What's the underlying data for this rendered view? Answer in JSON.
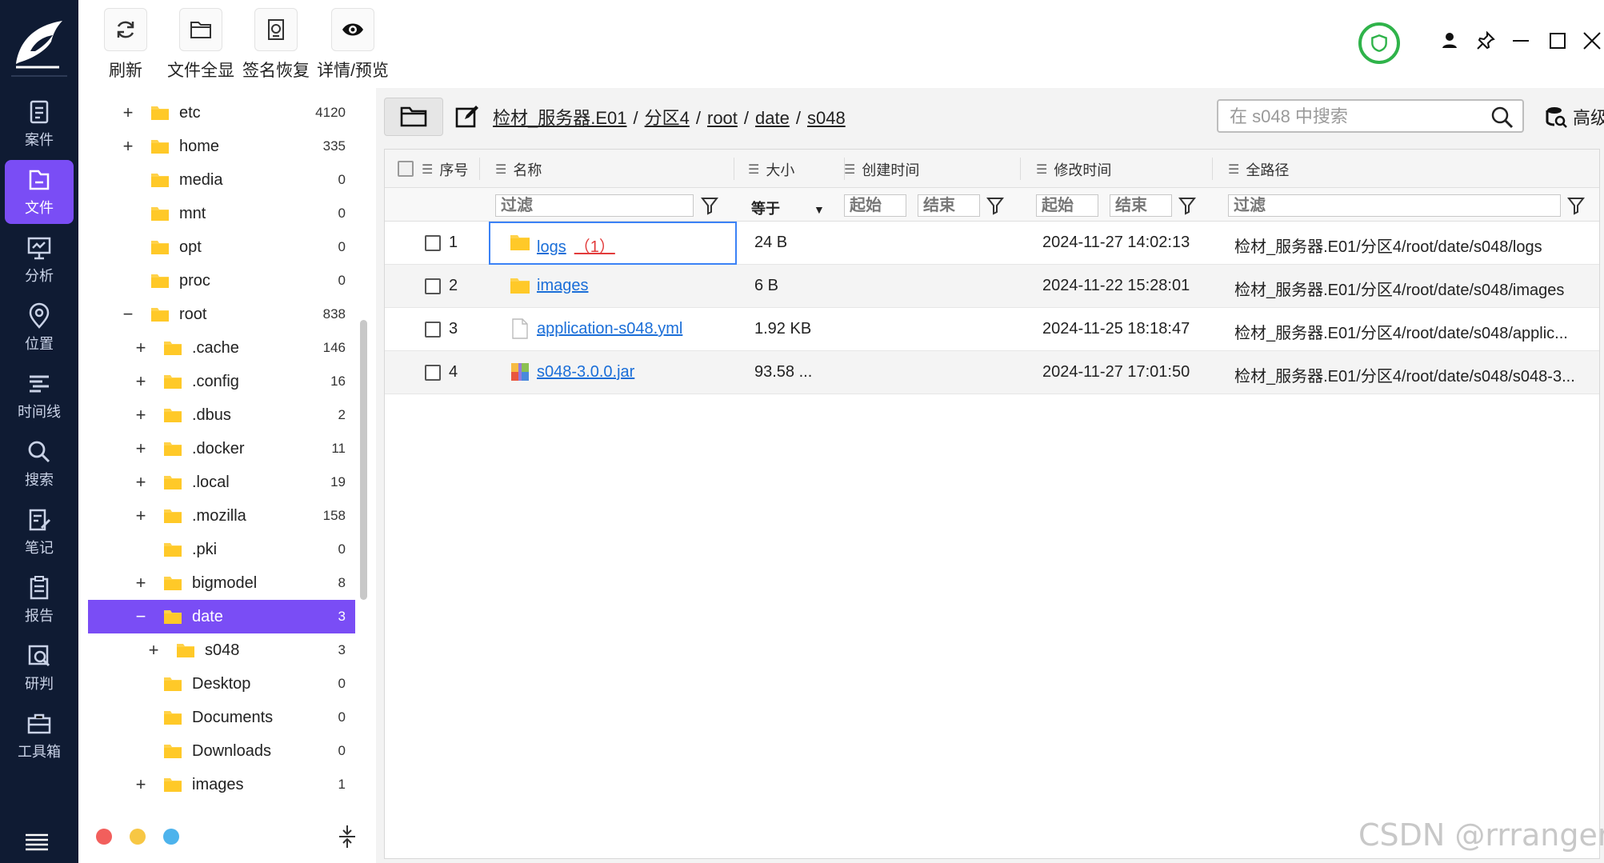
{
  "colors": {
    "nav_bg": "#0f1b33",
    "accent": "#7a4df5",
    "link": "#1a6ed8",
    "badge_red": "#e23b3b",
    "shield_green": "#2fb34a"
  },
  "leftnav": {
    "items": [
      {
        "label": "案件",
        "icon": "case-icon"
      },
      {
        "label": "文件",
        "icon": "file-icon",
        "active": true
      },
      {
        "label": "分析",
        "icon": "analysis-icon"
      },
      {
        "label": "位置",
        "icon": "location-icon"
      },
      {
        "label": "时间线",
        "icon": "timeline-icon"
      },
      {
        "label": "搜索",
        "icon": "search-icon"
      },
      {
        "label": "笔记",
        "icon": "note-icon"
      },
      {
        "label": "报告",
        "icon": "report-icon"
      },
      {
        "label": "研判",
        "icon": "judge-icon"
      },
      {
        "label": "工具箱",
        "icon": "toolbox-icon"
      }
    ]
  },
  "toolbar": {
    "refresh": "刷新",
    "show_all": "文件全显",
    "signature_recover": "签名恢复",
    "detail_preview": "详情/预览"
  },
  "tree": {
    "items": [
      {
        "toggle": "+",
        "name": "etc",
        "count": "4120"
      },
      {
        "toggle": "+",
        "name": "home",
        "count": "335"
      },
      {
        "toggle": "",
        "name": "media",
        "count": "0"
      },
      {
        "toggle": "",
        "name": "mnt",
        "count": "0"
      },
      {
        "toggle": "",
        "name": "opt",
        "count": "0"
      },
      {
        "toggle": "",
        "name": "proc",
        "count": "0"
      },
      {
        "toggle": "−",
        "name": "root",
        "count": "838"
      },
      {
        "toggle": "+",
        "name": ".cache",
        "count": "146"
      },
      {
        "toggle": "+",
        "name": ".config",
        "count": "16"
      },
      {
        "toggle": "+",
        "name": ".dbus",
        "count": "2"
      },
      {
        "toggle": "+",
        "name": ".docker",
        "count": "11"
      },
      {
        "toggle": "+",
        "name": ".local",
        "count": "19"
      },
      {
        "toggle": "+",
        "name": ".mozilla",
        "count": "158"
      },
      {
        "toggle": "",
        "name": ".pki",
        "count": "0"
      },
      {
        "toggle": "+",
        "name": "bigmodel",
        "count": "8"
      },
      {
        "toggle": "−",
        "name": "date",
        "count": "3",
        "selected": true
      },
      {
        "toggle": "+",
        "name": "s048",
        "count": "3"
      },
      {
        "toggle": "",
        "name": "Desktop",
        "count": "0"
      },
      {
        "toggle": "",
        "name": "Documents",
        "count": "0"
      },
      {
        "toggle": "",
        "name": "Downloads",
        "count": "0"
      },
      {
        "toggle": "+",
        "name": "images",
        "count": "1"
      }
    ]
  },
  "breadcrumb": {
    "parts": [
      "检材_服务器.E01",
      "分区4",
      "root",
      "date",
      "s048"
    ],
    "separator": "/"
  },
  "search": {
    "placeholder": "在 s048 中搜索",
    "advanced_label": "高级"
  },
  "table": {
    "headers": {
      "index": "序号",
      "name": "名称",
      "size": "大小",
      "created": "创建时间",
      "modified": "修改时间",
      "path": "全路径"
    },
    "filters": {
      "name": "过滤",
      "size_op": "等于",
      "created_start": "起始",
      "created_end": "结束",
      "modified_start": "起始",
      "modified_end": "结束",
      "path": "过滤"
    },
    "rows": [
      {
        "index": "1",
        "name": "logs",
        "badge": "（1）",
        "icon": "folder-icon",
        "size": "24 B",
        "created": "",
        "modified": "2024-11-27 14:02:13",
        "path": "检材_服务器.E01/分区4/root/date/s048/logs"
      },
      {
        "index": "2",
        "name": "images",
        "badge": "",
        "icon": "folder-icon",
        "size": "6 B",
        "created": "",
        "modified": "2024-11-22 15:28:01",
        "path": "检材_服务器.E01/分区4/root/date/s048/images"
      },
      {
        "index": "3",
        "name": "application-s048.yml",
        "badge": "",
        "icon": "file-doc-icon",
        "size": "1.92 KB",
        "created": "",
        "modified": "2024-11-25 18:18:47",
        "path": "检材_服务器.E01/分区4/root/date/s048/applic..."
      },
      {
        "index": "4",
        "name": "s048-3.0.0.jar",
        "badge": "",
        "icon": "jar-archive-icon",
        "size": "93.58 ...",
        "created": "",
        "modified": "2024-11-27 17:01:50",
        "path": "检材_服务器.E01/分区4/root/date/s048/s048-3..."
      }
    ]
  },
  "watermark": "CSDN @rrranger_"
}
